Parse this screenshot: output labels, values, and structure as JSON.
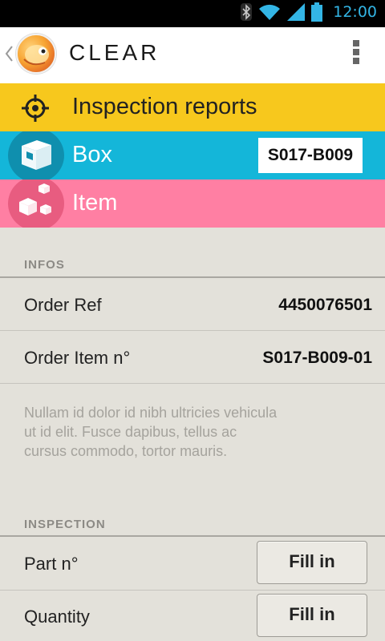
{
  "status_bar": {
    "time": "12:00",
    "icons": [
      "bluetooth-icon",
      "wifi-icon",
      "signal-icon",
      "battery-icon"
    ],
    "accent_color": "#33b5e5"
  },
  "action_bar": {
    "title": "CLEAR",
    "icons": [
      "up-chevron-icon",
      "app-logo-icon",
      "overflow-menu-icon"
    ]
  },
  "breadcrumbs": [
    {
      "label": "Inspection reports",
      "icon": "target-icon",
      "color": "#f7c81d"
    },
    {
      "label": "Box",
      "icon": "box-icon",
      "color": "#14b6d9",
      "badge": "S017-B009"
    },
    {
      "label": "Item",
      "icon": "items-icon",
      "color": "#ff7fa3"
    }
  ],
  "infos": {
    "header": "INFOS",
    "rows": [
      {
        "label": "Order Ref",
        "value": "4450076501"
      },
      {
        "label": "Order Item n°",
        "value": "S017-B009-01"
      }
    ],
    "description_lines": [
      "Nullam id dolor id nibh ultricies vehicula",
      "ut id elit. Fusce dapibus, tellus ac",
      "cursus commodo, tortor mauris."
    ]
  },
  "inspection": {
    "header": "INSPECTION",
    "rows": [
      {
        "label": "Part n°",
        "button": "Fill in"
      },
      {
        "label": "Quantity",
        "button": "Fill in"
      }
    ]
  }
}
